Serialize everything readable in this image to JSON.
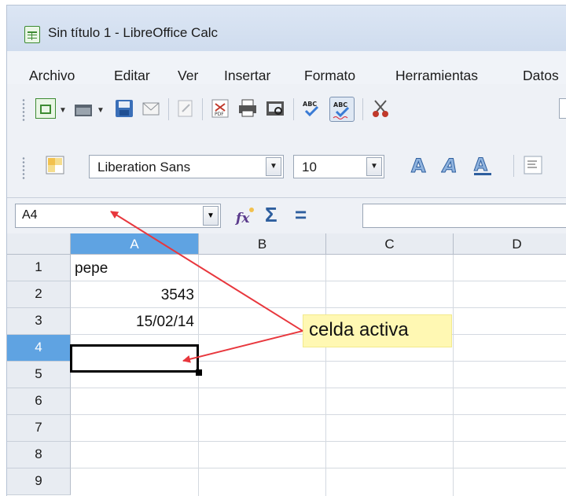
{
  "window": {
    "title": "Sin título 1 - LibreOffice Calc",
    "app_icon": "calc-spreadsheet-icon"
  },
  "menubar": {
    "items": [
      {
        "label": "Archivo"
      },
      {
        "label": "Editar"
      },
      {
        "label": "Ver"
      },
      {
        "label": "Insertar"
      },
      {
        "label": "Formato"
      },
      {
        "label": "Herramientas"
      },
      {
        "label": "Datos"
      }
    ]
  },
  "toolbar_standard": {
    "icons": [
      "new-document-icon",
      "open-folder-icon",
      "save-icon",
      "email-icon",
      "edit-file-icon",
      "export-pdf-icon",
      "print-icon",
      "print-preview-icon",
      "spellcheck-icon",
      "autospellcheck-icon",
      "cut-icon"
    ]
  },
  "toolbar_formatting": {
    "styles_icon": "styles-icon",
    "font_name": "Liberation Sans",
    "font_size": "10",
    "bold_icon": "bold-icon",
    "italic_icon": "italic-icon",
    "underline_icon": "underline-icon"
  },
  "formula_bar": {
    "name_box": "A4",
    "function_wizard_icon": "function-wizard-icon",
    "sum_symbol": "Σ",
    "equals_symbol": "=",
    "input_value": ""
  },
  "sheet": {
    "columns": [
      "A",
      "B",
      "C",
      "D"
    ],
    "rows": [
      "1",
      "2",
      "3",
      "4",
      "5",
      "6",
      "7",
      "8",
      "9"
    ],
    "active_cell": "A4",
    "cells": {
      "A1": "pepe",
      "A2": "3543",
      "A3": "15/02/14"
    }
  },
  "annotation": {
    "label": "celda activa",
    "arrow_color": "#e8373d",
    "label_background": "#fff8b3"
  },
  "colors": {
    "active_header": "#5fa3e2",
    "titlebar": "#dce6f4"
  }
}
